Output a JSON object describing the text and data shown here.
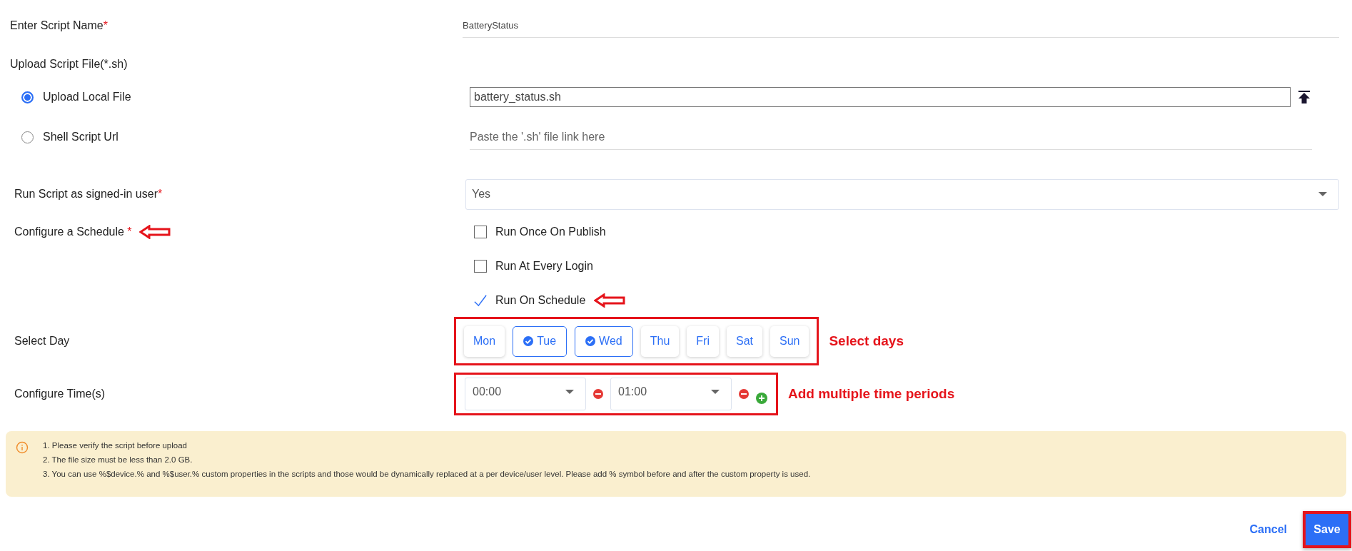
{
  "script_name": {
    "label": "Enter Script Name",
    "required_mark": "*",
    "value": "BatteryStatus"
  },
  "upload": {
    "label": "Upload Script File(*.sh)",
    "options": [
      {
        "kind": "file",
        "label": "Upload Local File",
        "selected": true,
        "value": "battery_status.sh"
      },
      {
        "kind": "url",
        "label": "Shell Script Url",
        "selected": false,
        "placeholder": "Paste the '.sh' file link here"
      }
    ]
  },
  "run_as_user": {
    "label": "Run Script as signed-in user",
    "required_mark": "*",
    "value": "Yes"
  },
  "schedule": {
    "label": "Configure a Schedule",
    "required_mark": "*",
    "annotated": true,
    "options": [
      {
        "label": "Run Once On Publish",
        "checked": false,
        "annotated": false
      },
      {
        "label": "Run At Every Login",
        "checked": false,
        "annotated": false
      },
      {
        "label": "Run On Schedule",
        "checked": true,
        "annotated": true
      }
    ]
  },
  "days": {
    "label": "Select Day",
    "annotation": "Select days",
    "items": [
      {
        "label": "Mon",
        "selected": false
      },
      {
        "label": "Tue",
        "selected": true
      },
      {
        "label": "Wed",
        "selected": true
      },
      {
        "label": "Thu",
        "selected": false
      },
      {
        "label": "Fri",
        "selected": false
      },
      {
        "label": "Sat",
        "selected": false
      },
      {
        "label": "Sun",
        "selected": false
      }
    ]
  },
  "times": {
    "label": "Configure Time(s)",
    "annotation": "Add multiple time periods",
    "slots": [
      {
        "value": "00:00"
      },
      {
        "value": "01:00"
      }
    ]
  },
  "notes": [
    "1. Please verify the script before upload",
    "2. The file size must be less than 2.0 GB.",
    "3. You can use %$device.% and %$user.% custom properties in the scripts and those would be dynamically replaced at a per device/user level. Please add % symbol before and after the custom property is used."
  ],
  "actions": {
    "cancel": "Cancel",
    "save": "Save",
    "save_highlighted": true
  }
}
